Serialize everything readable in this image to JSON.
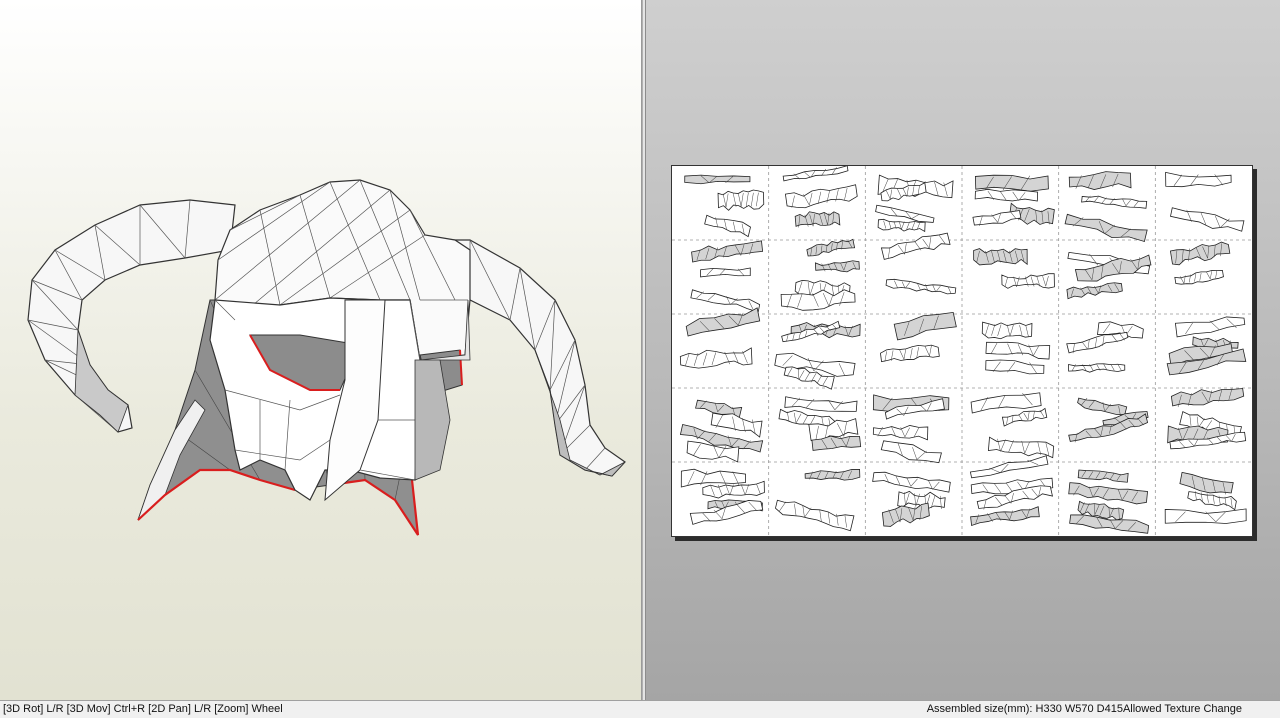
{
  "viewport_3d": {
    "model_name_icon": "horned-helmet-model",
    "colors": {
      "bg_top": "#ffffff",
      "bg_bottom": "#e2e2d2",
      "face": "#ffffff",
      "shadow": "#8f8f8f",
      "edge": "#333333",
      "cut_edge": "#d91e1e"
    }
  },
  "viewport_2d": {
    "sheet": {
      "columns": 6,
      "rows": 5,
      "cell_border_style": "dashed"
    },
    "colors": {
      "bg": "#b9b9b9",
      "sheet": "#ffffff",
      "part_fill": "#ffffff",
      "part_shade": "#9c9c9c",
      "part_edge": "#222222"
    }
  },
  "statusbar": {
    "left_text": "[3D Rot] L/R [3D Mov] Ctrl+R [2D Pan] L/R [Zoom] Wheel",
    "right_text": "Assembled size(mm): H330 W570 D415Allowed Texture Change"
  }
}
